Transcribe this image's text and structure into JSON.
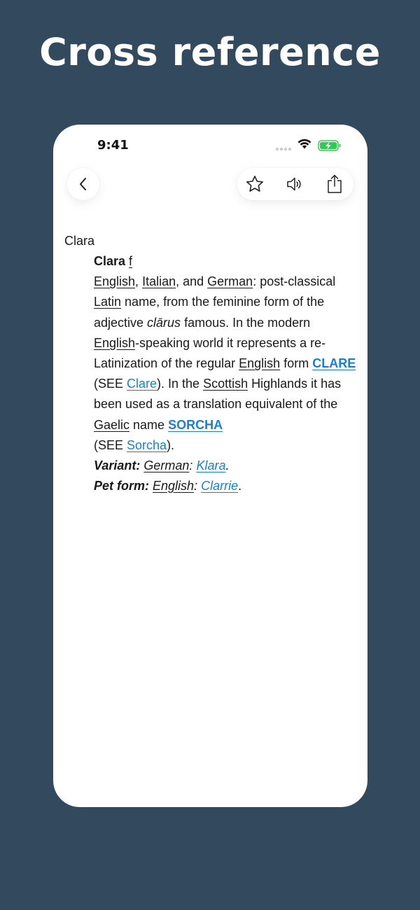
{
  "headline": "Cross reference",
  "status": {
    "time": "9:41"
  },
  "toolbar": {
    "back_icon": "chevron-left-icon",
    "favorite_icon": "star-icon",
    "audio_icon": "speaker-icon",
    "share_icon": "share-icon"
  },
  "entry": {
    "title": "Clara",
    "headword": "Clara",
    "gender": "f",
    "langs": [
      "English",
      "Italian",
      "German"
    ],
    "and": ", and ",
    "comma": ", ",
    "def1": ": post-classical ",
    "latin": "Latin",
    "def2": " name, from the feminine form of the adjective ",
    "clarus": "clārus",
    "def3": " famous. In the modern ",
    "english2": "English",
    "def4": "-speaking world it represents a re-Latinization of the regular ",
    "english3": "English",
    "def5": " form ",
    "xref1": "CLARE",
    "see1_pre": " (SEE ",
    "see1_link": "Clare",
    "see1_post": "). In the ",
    "scottish": "Scottish",
    "def6": " Highlands it has been used as a translation equivalent of the ",
    "gaelic": "Gaelic",
    "def7": " name ",
    "xref2": "SORCHA",
    "see2_pre": "(SEE ",
    "see2_link": "Sorcha",
    "see2_post": ").",
    "variant_label": "Variant:",
    "variant_lang": "German",
    "colon": ":",
    "variant_link": "Klara",
    "period": ".",
    "pet_label": "Pet form:",
    "pet_lang": "English",
    "pet_link": "Clarrie"
  },
  "colors": {
    "background": "#33495e",
    "link": "#1a7fd4",
    "battery": "#34c759"
  }
}
